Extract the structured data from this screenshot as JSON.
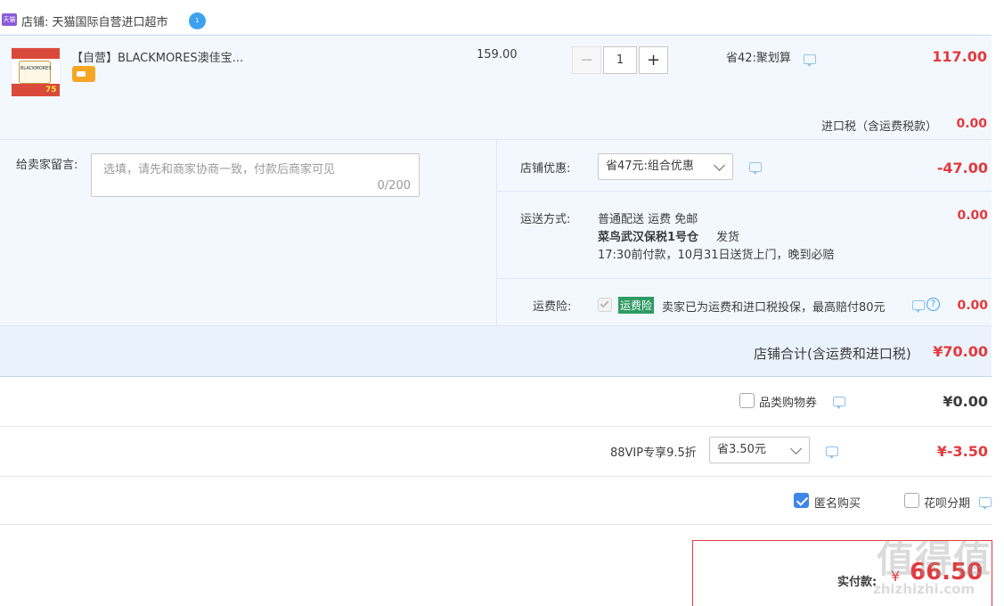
{
  "shop": {
    "label": "店铺: 天猫国际自营进口超市",
    "shop_badge": "天猫",
    "chat_badge": "1"
  },
  "item": {
    "title": "【自营】BLACKMORES澳佳宝...",
    "thumb_text": "BLACKMORES",
    "thumb_price": "75",
    "unit_price": "159.00",
    "quantity": "1",
    "minus_label": "−",
    "plus_label": "+",
    "promo": "省42:聚划算",
    "total": "117.00"
  },
  "import_tax": {
    "label": "进口税（含运费税款）",
    "value": "0.00"
  },
  "message": {
    "label": "给卖家留言:",
    "placeholder": "选填，请先和商家协商一致，付款后商家可见",
    "counter": "0/200"
  },
  "shop_discount": {
    "label": "店铺优惠:",
    "selected": "省47元:组合优惠",
    "value": "-47.00"
  },
  "shipping": {
    "label": "运送方式:",
    "line1": "普通配送 运费 免邮",
    "warehouse": "菜鸟武汉保税1号仓",
    "ship_word": "发货",
    "line3": "17:30前付款，10月31日送货上门，晚到必赔",
    "value": "0.00"
  },
  "insurance": {
    "label": "运费险:",
    "badge": "运费险",
    "text": "卖家已为运费和进口税投保，最高赔付80元",
    "help_icon": "?",
    "value": "0.00"
  },
  "shop_total": {
    "label": "店铺合计(含运费和进口税)",
    "value": "¥70.00"
  },
  "coupon": {
    "label": "品类购物券",
    "value": "¥0.00"
  },
  "vip": {
    "label": "88VIP专享9.5折",
    "selected": "省3.50元",
    "value": "¥-3.50"
  },
  "options": {
    "anonymous": "匿名购买",
    "huabei": "花呗分期"
  },
  "pay": {
    "label": "实付款:",
    "currency": "¥",
    "amount": "66.50"
  },
  "watermark": {
    "big": "值得值",
    "small": "zhizhizhi.com"
  },
  "colors": {
    "accent_red": "#e4393c",
    "row_bg": "#f3f8fe",
    "border_blue": "#b9d7f2",
    "insurance_green": "#2f9b63"
  }
}
